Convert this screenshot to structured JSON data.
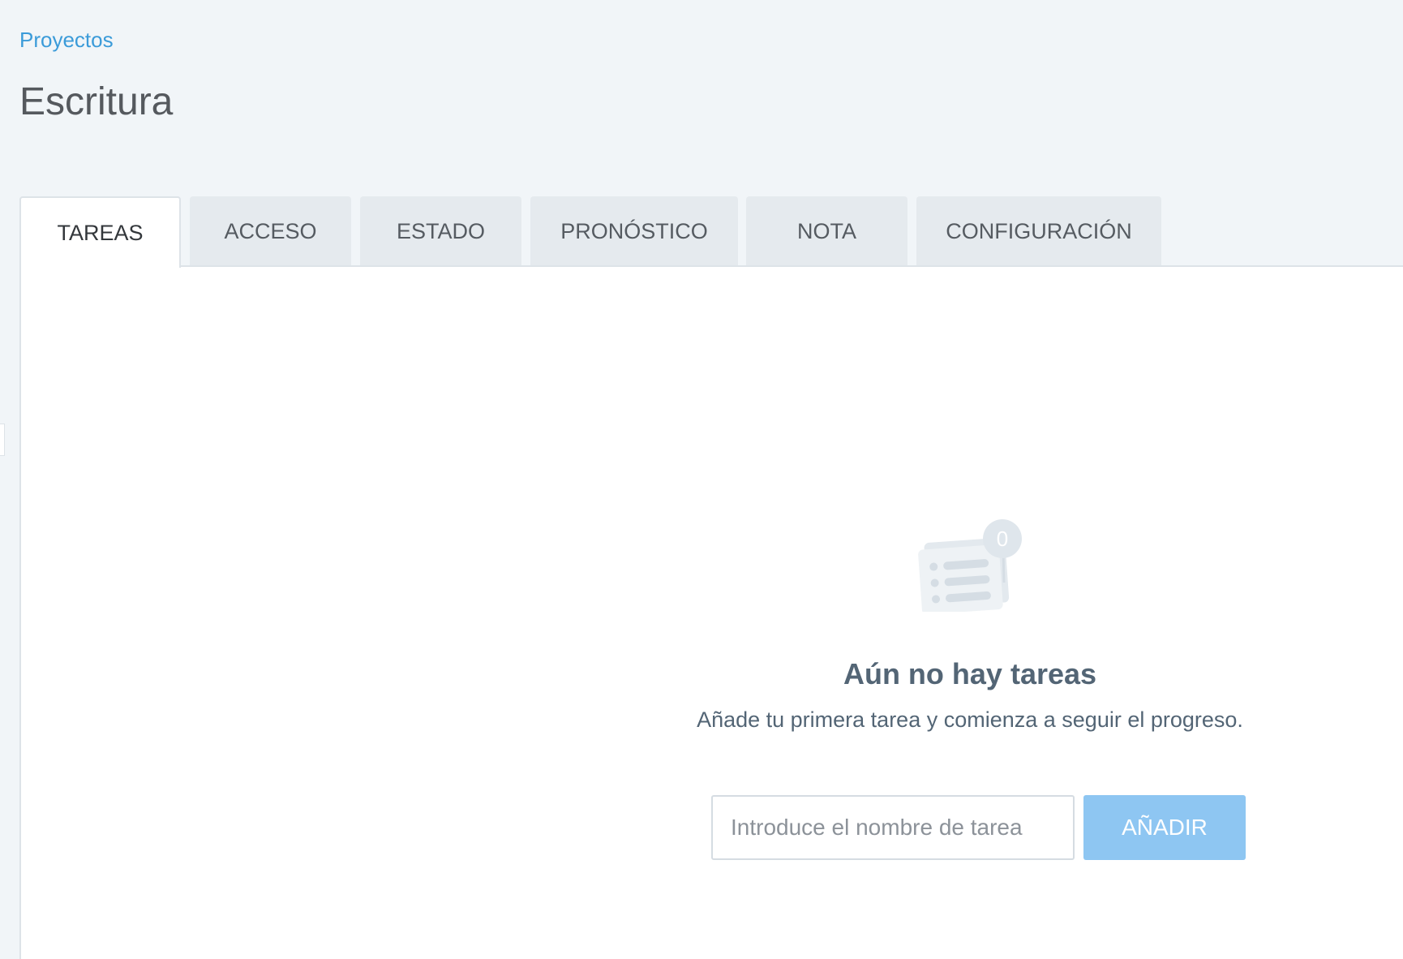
{
  "breadcrumb": {
    "label": "Proyectos"
  },
  "page": {
    "title": "Escritura"
  },
  "tabs": [
    {
      "label": "TAREAS",
      "active": true
    },
    {
      "label": "ACCESO",
      "active": false
    },
    {
      "label": "ESTADO",
      "active": false
    },
    {
      "label": "PRONÓSTICO",
      "active": false
    },
    {
      "label": "NOTA",
      "active": false
    },
    {
      "label": "CONFIGURACIÓN",
      "active": false
    }
  ],
  "empty_state": {
    "icon": "task-list-icon",
    "badge_count": "0",
    "title": "Aún no hay tareas",
    "subtitle": "Añade tu primera tarea y comienza a seguir el progreso."
  },
  "task_form": {
    "input_value": "",
    "input_placeholder": "Introduce el nombre de tarea",
    "add_label": "AÑADIR"
  },
  "colors": {
    "accent": "#3b9bd9",
    "button": "#8ec6f2",
    "background": "#f1f5f8"
  }
}
